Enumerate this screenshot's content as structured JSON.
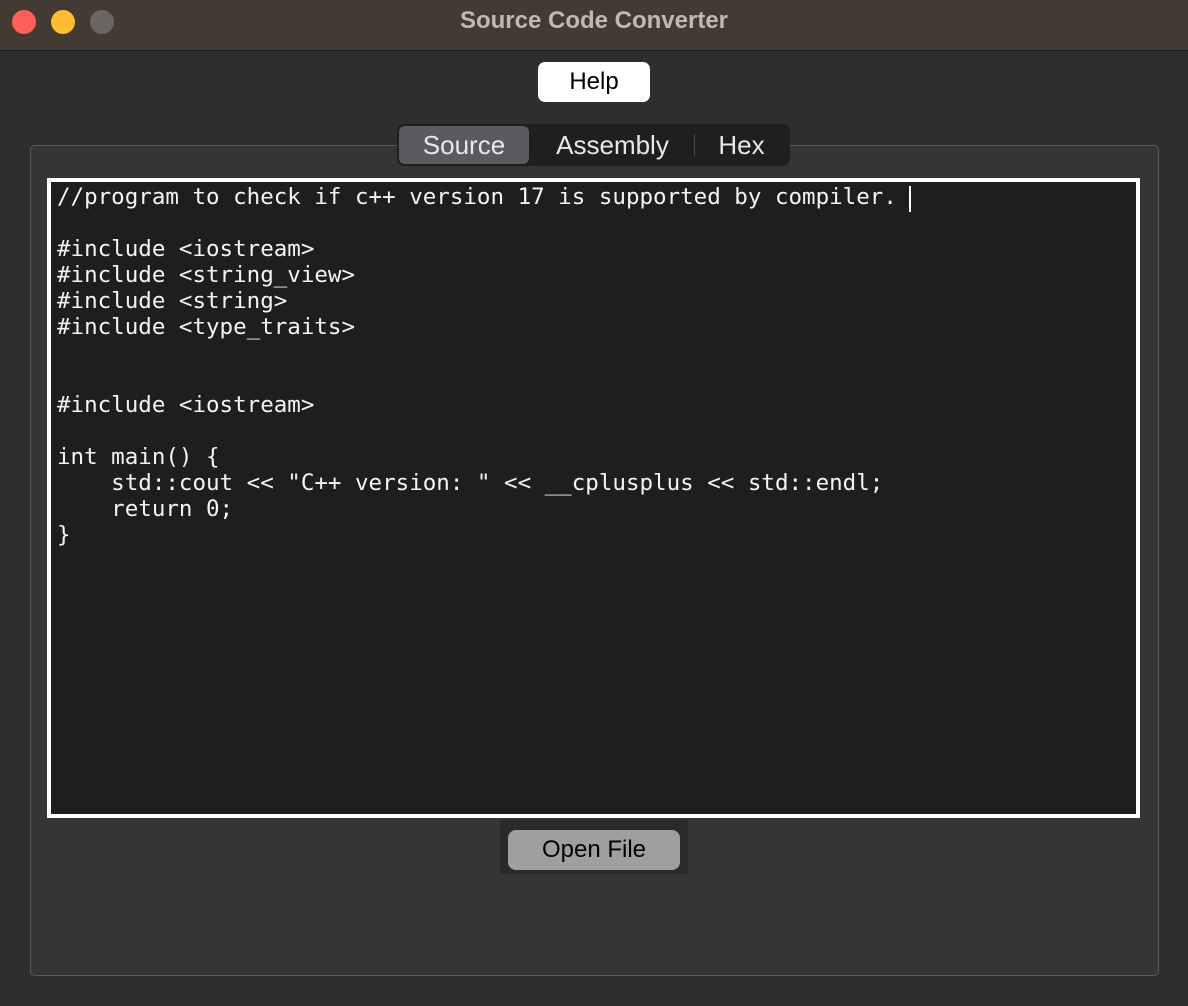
{
  "window": {
    "title": "Source Code Converter"
  },
  "toolbar": {
    "help_label": "Help"
  },
  "tabs": [
    {
      "label": "Source",
      "selected": true
    },
    {
      "label": "Assembly",
      "selected": false
    },
    {
      "label": "Hex",
      "selected": false
    }
  ],
  "editor": {
    "content": "//program to check if c++ version 17 is supported by compiler.\n\n#include <iostream>\n#include <string_view>\n#include <string>\n#include <type_traits>\n\n\n#include <iostream>\n\nint main() {\n    std::cout << \"C++ version: \" << __cplusplus << std::endl;\n    return 0;\n}"
  },
  "footer": {
    "open_file_label": "Open File"
  },
  "colors": {
    "titlebar": "#433a34",
    "close": "#fe5f57",
    "minimize": "#febc2e",
    "zoom_inactive": "#6b6662",
    "editor_bg": "#1e1e1e",
    "selected_tab": "#5b5b5f"
  }
}
